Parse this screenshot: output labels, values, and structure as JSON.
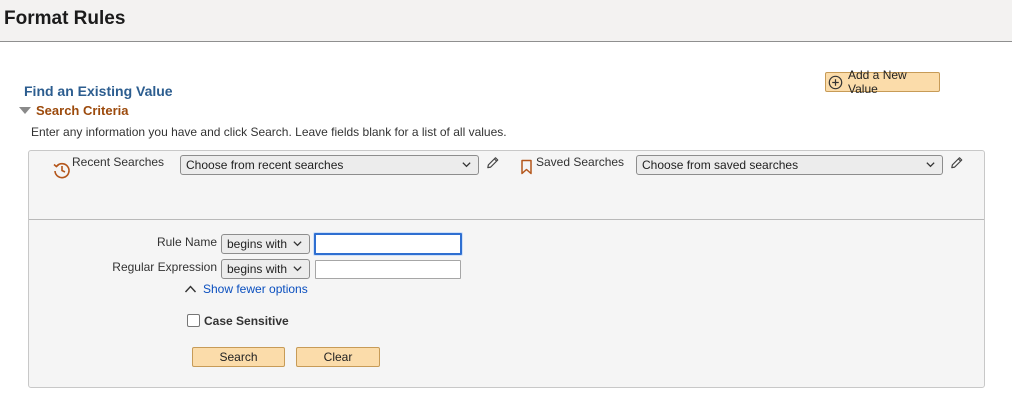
{
  "page": {
    "title": "Format Rules"
  },
  "toolbar": {
    "add_new_value_label": "Add a New Value"
  },
  "find": {
    "title": "Find an Existing Value",
    "criteria_label": "Search Criteria",
    "instructions": "Enter any information you have and click Search. Leave fields blank for a list of all values."
  },
  "recent": {
    "label": "Recent Searches",
    "selected": "Choose from recent searches"
  },
  "saved": {
    "label": "Saved Searches",
    "selected": "Choose from saved searches"
  },
  "fields": {
    "rule_name": {
      "label": "Rule Name",
      "operator": "begins with",
      "value": ""
    },
    "regular_expression": {
      "label": "Regular Expression",
      "operator": "begins with",
      "value": ""
    }
  },
  "options": {
    "show_fewer_label": "Show fewer options",
    "case_sensitive_label": "Case Sensitive",
    "case_sensitive_checked": false
  },
  "buttons": {
    "search": "Search",
    "clear": "Clear"
  },
  "icons": {
    "add": "plus-circle-icon",
    "recent": "history-icon",
    "saved": "bookmark-icon",
    "edit": "pencil-icon",
    "collapse": "chevron-up-icon",
    "dropdown": "chevron-down-icon",
    "toggle": "triangle-down-icon"
  },
  "colors": {
    "button_bg": "#fbdcaa",
    "title_blue": "#2c5d8f",
    "section_orange": "#9c4a0c",
    "link_blue": "#0a4fbf",
    "focus_blue": "#2f6fd1"
  }
}
